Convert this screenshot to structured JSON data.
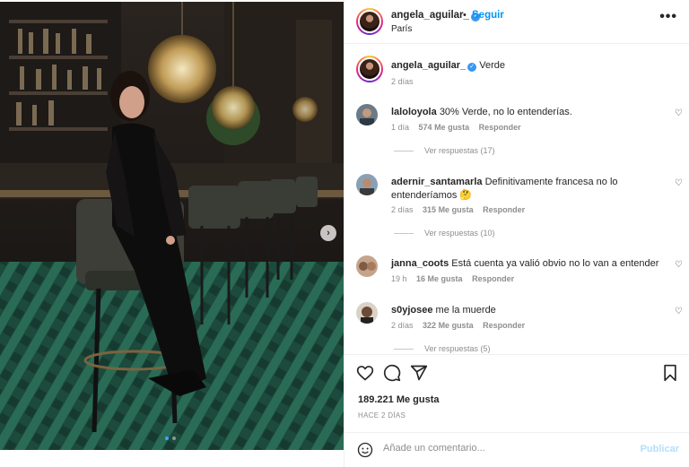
{
  "header": {
    "username": "angela_aguilar_",
    "separator": "•",
    "follow_label": "Seguir",
    "location": "París",
    "more_label": "•••"
  },
  "caption": {
    "username": "angela_aguilar_",
    "text": "Verde",
    "time": "2 días"
  },
  "comments": [
    {
      "username": "laloloyola",
      "text": "30% Verde, no lo entenderías.",
      "time": "1 día",
      "likes": "574 Me gusta",
      "reply": "Responder",
      "replies": "Ver respuestas (17)"
    },
    {
      "username": "adernir_santamarla",
      "text": "Definitivamente francesa no lo entenderíamos 🤔",
      "time": "2 días",
      "likes": "315 Me gusta",
      "reply": "Responder",
      "replies": "Ver respuestas (10)"
    },
    {
      "username": "janna_coots",
      "text": "Está cuenta ya valió obvio no lo van a entender",
      "time": "19 h",
      "likes": "16 Me gusta",
      "reply": "Responder"
    },
    {
      "username": "s0yjosee",
      "text": "me la muerde",
      "time": "2 días",
      "likes": "322 Me gusta",
      "reply": "Responder",
      "replies": "Ver respuestas (5)"
    }
  ],
  "actions": {
    "likes": "189.221 Me gusta",
    "date": "HACE 2 DÍAS"
  },
  "add_comment": {
    "placeholder": "Añade un comentario...",
    "publish": "Publicar"
  },
  "icons": {
    "heart": "heart-icon",
    "comment": "comment-icon",
    "share": "share-icon",
    "save": "bookmark-icon",
    "emoji": "emoji-icon",
    "next": "chevron-right-icon",
    "verified": "verified-badge-icon"
  },
  "colors": {
    "accent": "#0095f6",
    "verified": "#3897f0",
    "muted": "#8e8e8e"
  }
}
